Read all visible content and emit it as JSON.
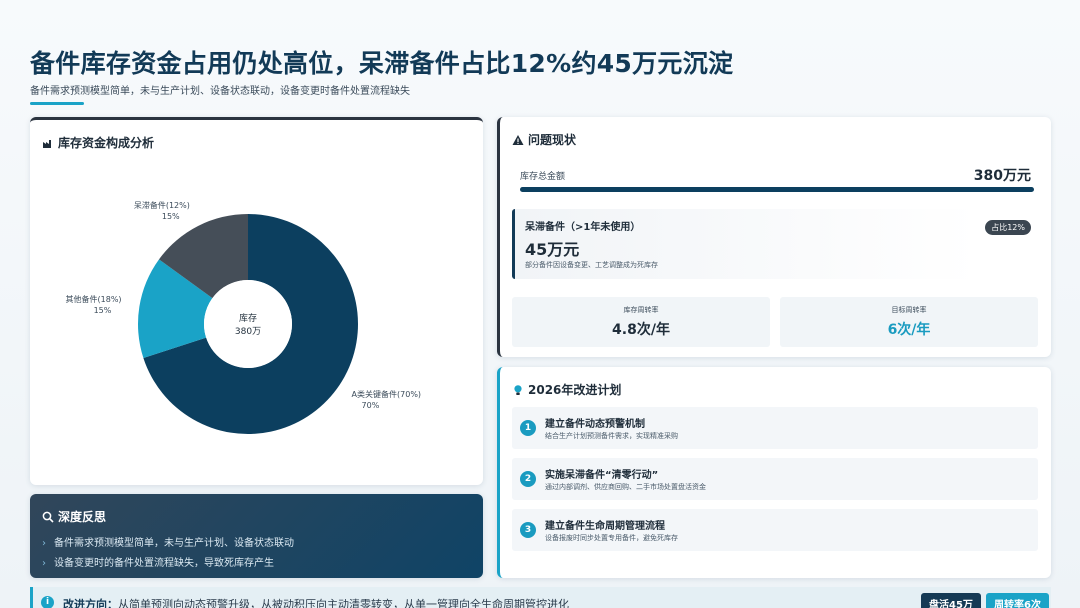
{
  "header": {
    "title": "备件库存资金占用仍处高位，呆滞备件占比12%约45万元沉淀",
    "subtitle": "备件需求预测模型简单，未与生产计划、设备状态联动，设备变更时备件处置流程缺失"
  },
  "chart_card": {
    "title": "库存资金构成分析",
    "icon": "factory-icon"
  },
  "chart_data": {
    "type": "pie",
    "title": "库存资金构成分析",
    "center_label": [
      "库存",
      "380万"
    ],
    "series": [
      {
        "name": "A类关键备件(70%)",
        "value": 70,
        "label": "70%",
        "color": "#0c3f5f"
      },
      {
        "name": "其他备件(18%)",
        "value": 15,
        "label": "15%",
        "color": "#1aa3c7"
      },
      {
        "name": "呆滞备件(12%)",
        "value": 15,
        "label": "15%",
        "color": "#454e58"
      }
    ]
  },
  "reflection": {
    "title": "深度反思",
    "icon": "search-icon",
    "items": [
      "备件需求预测模型简单，未与生产计划、设备状态联动",
      "设备变更时的备件处置流程缺失，导致死库存产生"
    ]
  },
  "problem": {
    "title": "问题现状",
    "icon": "warning-icon",
    "total_label": "库存总金额",
    "total_value": "380万元",
    "stuck_title": "呆滞备件（>1年未使用）",
    "stuck_value": "45万元",
    "stuck_note": "部分备件因设备变更、工艺调整成为死库存",
    "stuck_badge": "占比12%",
    "kpi": [
      {
        "label": "库存周转率",
        "value": "4.8次/年"
      },
      {
        "label": "目标周转率",
        "value": "6次/年"
      }
    ]
  },
  "plan": {
    "title": "2026年改进计划",
    "icon": "lightbulb-icon",
    "items": [
      {
        "num": "1",
        "title": "建立备件动态预警机制",
        "desc": "结合生产计划预测备件需求，实现精准采购"
      },
      {
        "num": "2",
        "title": "实施呆滞备件“清零行动”",
        "desc": "通过内部调剂、供应商回购、二手市场处置盘活资金"
      },
      {
        "num": "3",
        "title": "建立备件生命周期管理流程",
        "desc": "设备报废时同步处置专用备件，避免死库存"
      }
    ]
  },
  "bottom": {
    "label": "改进方向：",
    "text": "从简单预测向动态预警升级，从被动积压向主动清零转变，从单一管理向全生命周期管控进化",
    "pills": [
      "盘活45万",
      "周转率6次"
    ]
  },
  "colors": {
    "navy": "#0c3f5f",
    "accent": "#1aa3c7",
    "slate": "#454e58"
  }
}
